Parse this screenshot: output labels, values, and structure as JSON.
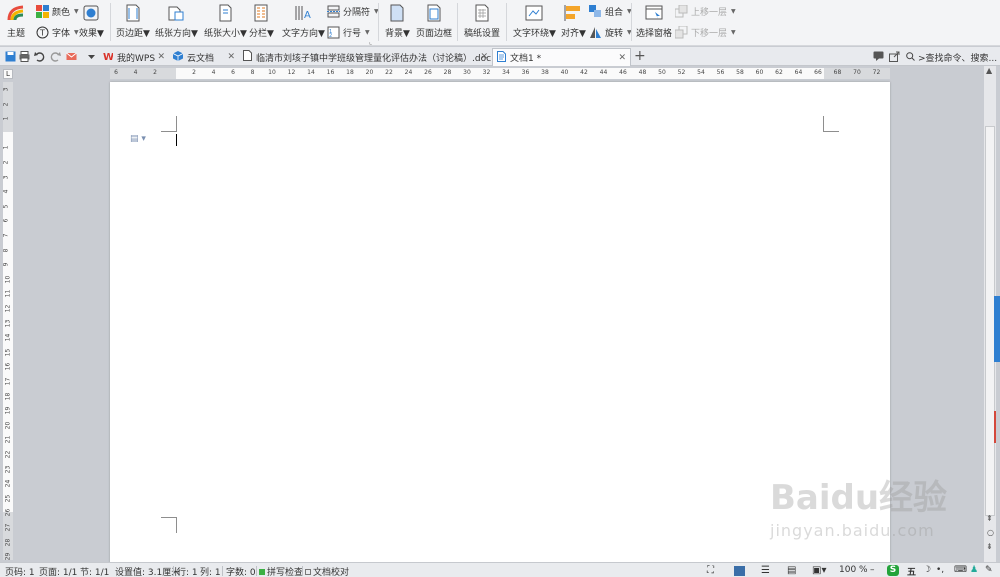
{
  "ribbon": {
    "theme_label": "主题",
    "color_label": "颜色",
    "font_label": "字体",
    "effect_label": "效果",
    "margins_label": "页边距",
    "orientation_label": "纸张方向",
    "size_label": "纸张大小",
    "columns_label": "分栏",
    "text_direction_label": "文字方向",
    "separator_label": "分隔符",
    "line_numbers_label": "行号",
    "background_label": "背景",
    "page_border_label": "页面边框",
    "grid_paper_label": "稿纸设置",
    "text_wrap_label": "文字环绕",
    "align_label": "对齐",
    "group_label": "组合",
    "rotate_label": "旋转",
    "selection_pane_label": "选择窗格",
    "bring_forward_label": "上移一层",
    "send_backward_label": "下移一层"
  },
  "tabs": [
    {
      "label": "我的WPS"
    },
    {
      "label": "云文档"
    },
    {
      "label": "临清市刘垓子镇中学班级管理量化评估办法（讨论稿）.doc"
    },
    {
      "label": "文档1 *"
    }
  ],
  "search": {
    "label": ">查找命令、搜索..."
  },
  "ruler": {
    "h_ticks": [
      "6",
      "4",
      "2",
      "",
      "2",
      "4",
      "6",
      "8",
      "10",
      "12",
      "14",
      "16",
      "18",
      "20",
      "22",
      "24",
      "26",
      "28",
      "30",
      "32",
      "34",
      "36",
      "38",
      "40",
      "42",
      "44",
      "46",
      "48",
      "50",
      "52",
      "54",
      "56",
      "58",
      "60",
      "62",
      "64",
      "66",
      "68",
      "70",
      "72"
    ],
    "v_ticks": [
      "3",
      "2",
      "1",
      "",
      "1",
      "2",
      "3",
      "4",
      "5",
      "6",
      "7",
      "8",
      "9",
      "10",
      "11",
      "12",
      "13",
      "14",
      "15",
      "16",
      "17",
      "18",
      "19",
      "20",
      "21",
      "22",
      "23",
      "24",
      "25",
      "26",
      "27",
      "28",
      "29"
    ]
  },
  "status": {
    "page": "页码: 1",
    "pages": "页面: 1/1",
    "section": "节: 1/1",
    "setting": "设置值: 3.1厘米",
    "row": "行: 1",
    "col": "列: 1",
    "words": "字数: 0",
    "spell_check": "拼写检查",
    "doc_review": "文档校对",
    "zoom": "100 %"
  },
  "watermark": {
    "brand": "Baidu经验",
    "url": "jingyan.baidu.com"
  },
  "colors": {
    "accent": "#2f7fd1",
    "ribbon_bg": "#f3f4f6",
    "workspace_bg": "#c9ccd2"
  }
}
